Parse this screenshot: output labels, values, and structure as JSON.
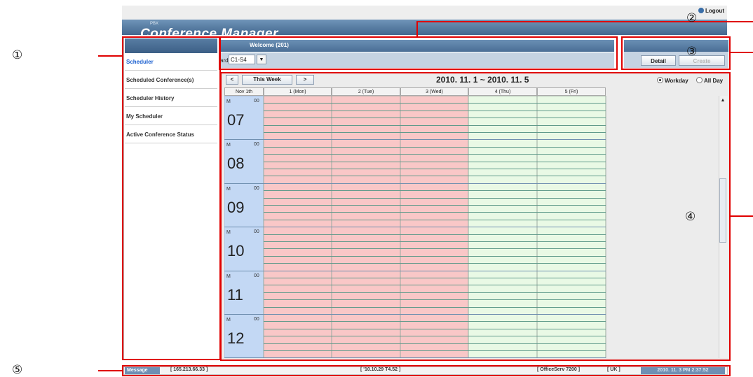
{
  "header": {
    "logout_label": "Logout",
    "app_title": "Conference Manager",
    "app_prefix": "PBX",
    "welcome": "Welcome   (201)",
    "board_label": "ard",
    "board_value": "C1-S4"
  },
  "buttons": {
    "detail": "Detail",
    "create": "Create"
  },
  "sidebar": {
    "items": [
      {
        "label": "Scheduler",
        "active": true
      },
      {
        "label": "Scheduled Conference(s)"
      },
      {
        "label": "Scheduler History"
      },
      {
        "label": "My Scheduler"
      },
      {
        "label": "Active Conference Status"
      }
    ]
  },
  "calendar": {
    "prev_label": "<",
    "this_week_label": "This Week",
    "next_label": ">",
    "range": "2010. 11. 1 ~ 2010. 11. 5",
    "view_options": [
      {
        "label": "Workday",
        "selected": true
      },
      {
        "label": "All Day",
        "selected": false
      }
    ],
    "week_label": "Nov  1th",
    "columns": [
      {
        "label": "1 (Mon)",
        "color": "#f9c7c7"
      },
      {
        "label": "2 (Tue)",
        "color": "#f9c7c7"
      },
      {
        "label": "3 (Wed)",
        "color": "#f9c7c7"
      },
      {
        "label": "4 (Thu)",
        "color": "#e9f9e5"
      },
      {
        "label": "5 (Fri)",
        "color": "#e9f9e5"
      }
    ],
    "hours": [
      {
        "m": "M",
        "minutes": "00",
        "hour": "07"
      },
      {
        "m": "M",
        "minutes": "00",
        "hour": "08"
      },
      {
        "m": "M",
        "minutes": "00",
        "hour": "09"
      },
      {
        "m": "M",
        "minutes": "00",
        "hour": "10"
      },
      {
        "m": "M",
        "minutes": "00",
        "hour": "11"
      },
      {
        "m": "M",
        "minutes": "00",
        "hour": "12"
      }
    ],
    "time_column_color": "#c3d8f4"
  },
  "status": {
    "message_label": "Message",
    "ip": "[ 165.213.66.33 ]",
    "version": "[ '10.10.29 T4.52 ]",
    "system": "[ OfficeServ 7200 ]",
    "locale": "[ UK ]",
    "datetime": "2010. 11. 3 PM 2:37:52"
  },
  "callouts": [
    "①",
    "②",
    "③",
    "④",
    "⑤"
  ],
  "accent_color": "#e00000"
}
